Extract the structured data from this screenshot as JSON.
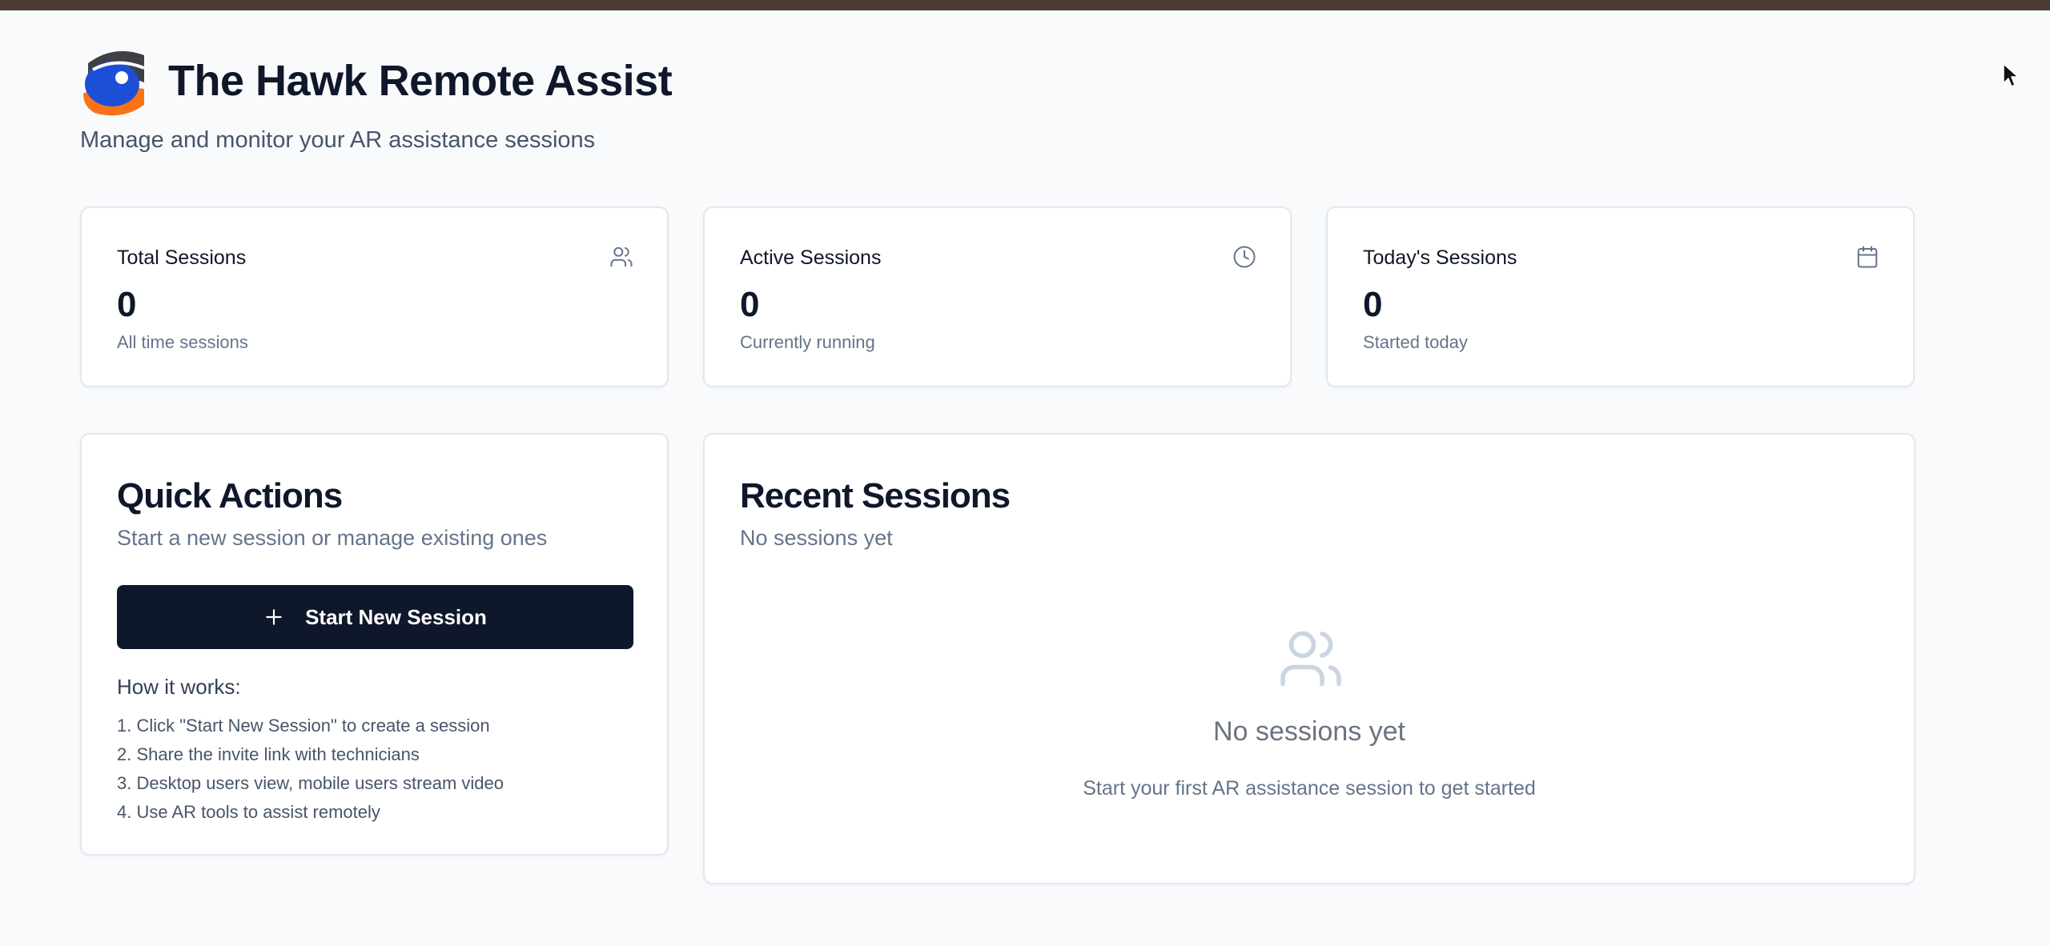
{
  "header": {
    "app_title": "The Hawk Remote Assist",
    "subtitle": "Manage and monitor your AR assistance sessions",
    "logo_icon": "hawk-eye-logo"
  },
  "stats": [
    {
      "label": "Total Sessions",
      "value": "0",
      "description": "All time sessions",
      "icon": "users-icon"
    },
    {
      "label": "Active Sessions",
      "value": "0",
      "description": "Currently running",
      "icon": "clock-icon"
    },
    {
      "label": "Today's Sessions",
      "value": "0",
      "description": "Started today",
      "icon": "calendar-icon"
    }
  ],
  "quick_actions": {
    "title": "Quick Actions",
    "description": "Start a new session or manage existing ones",
    "start_button_label": "Start New Session",
    "how_it_works_title": "How it works:",
    "steps": [
      "1. Click \"Start New Session\" to create a session",
      "2. Share the invite link with technicians",
      "3. Desktop users view, mobile users stream video",
      "4. Use AR tools to assist remotely"
    ]
  },
  "recent_sessions": {
    "title": "Recent Sessions",
    "description": "No sessions yet",
    "empty_title": "No sessions yet",
    "empty_description": "Start your first AR assistance session to get started",
    "empty_icon": "users-icon"
  },
  "colors": {
    "background": "#f8fafc",
    "primary": "#0f172a",
    "muted_text": "#64748b",
    "border": "#e2e8f0",
    "top_bar": "#4a3a33",
    "logo_blue": "#1d4ed8",
    "logo_orange": "#f97316"
  }
}
